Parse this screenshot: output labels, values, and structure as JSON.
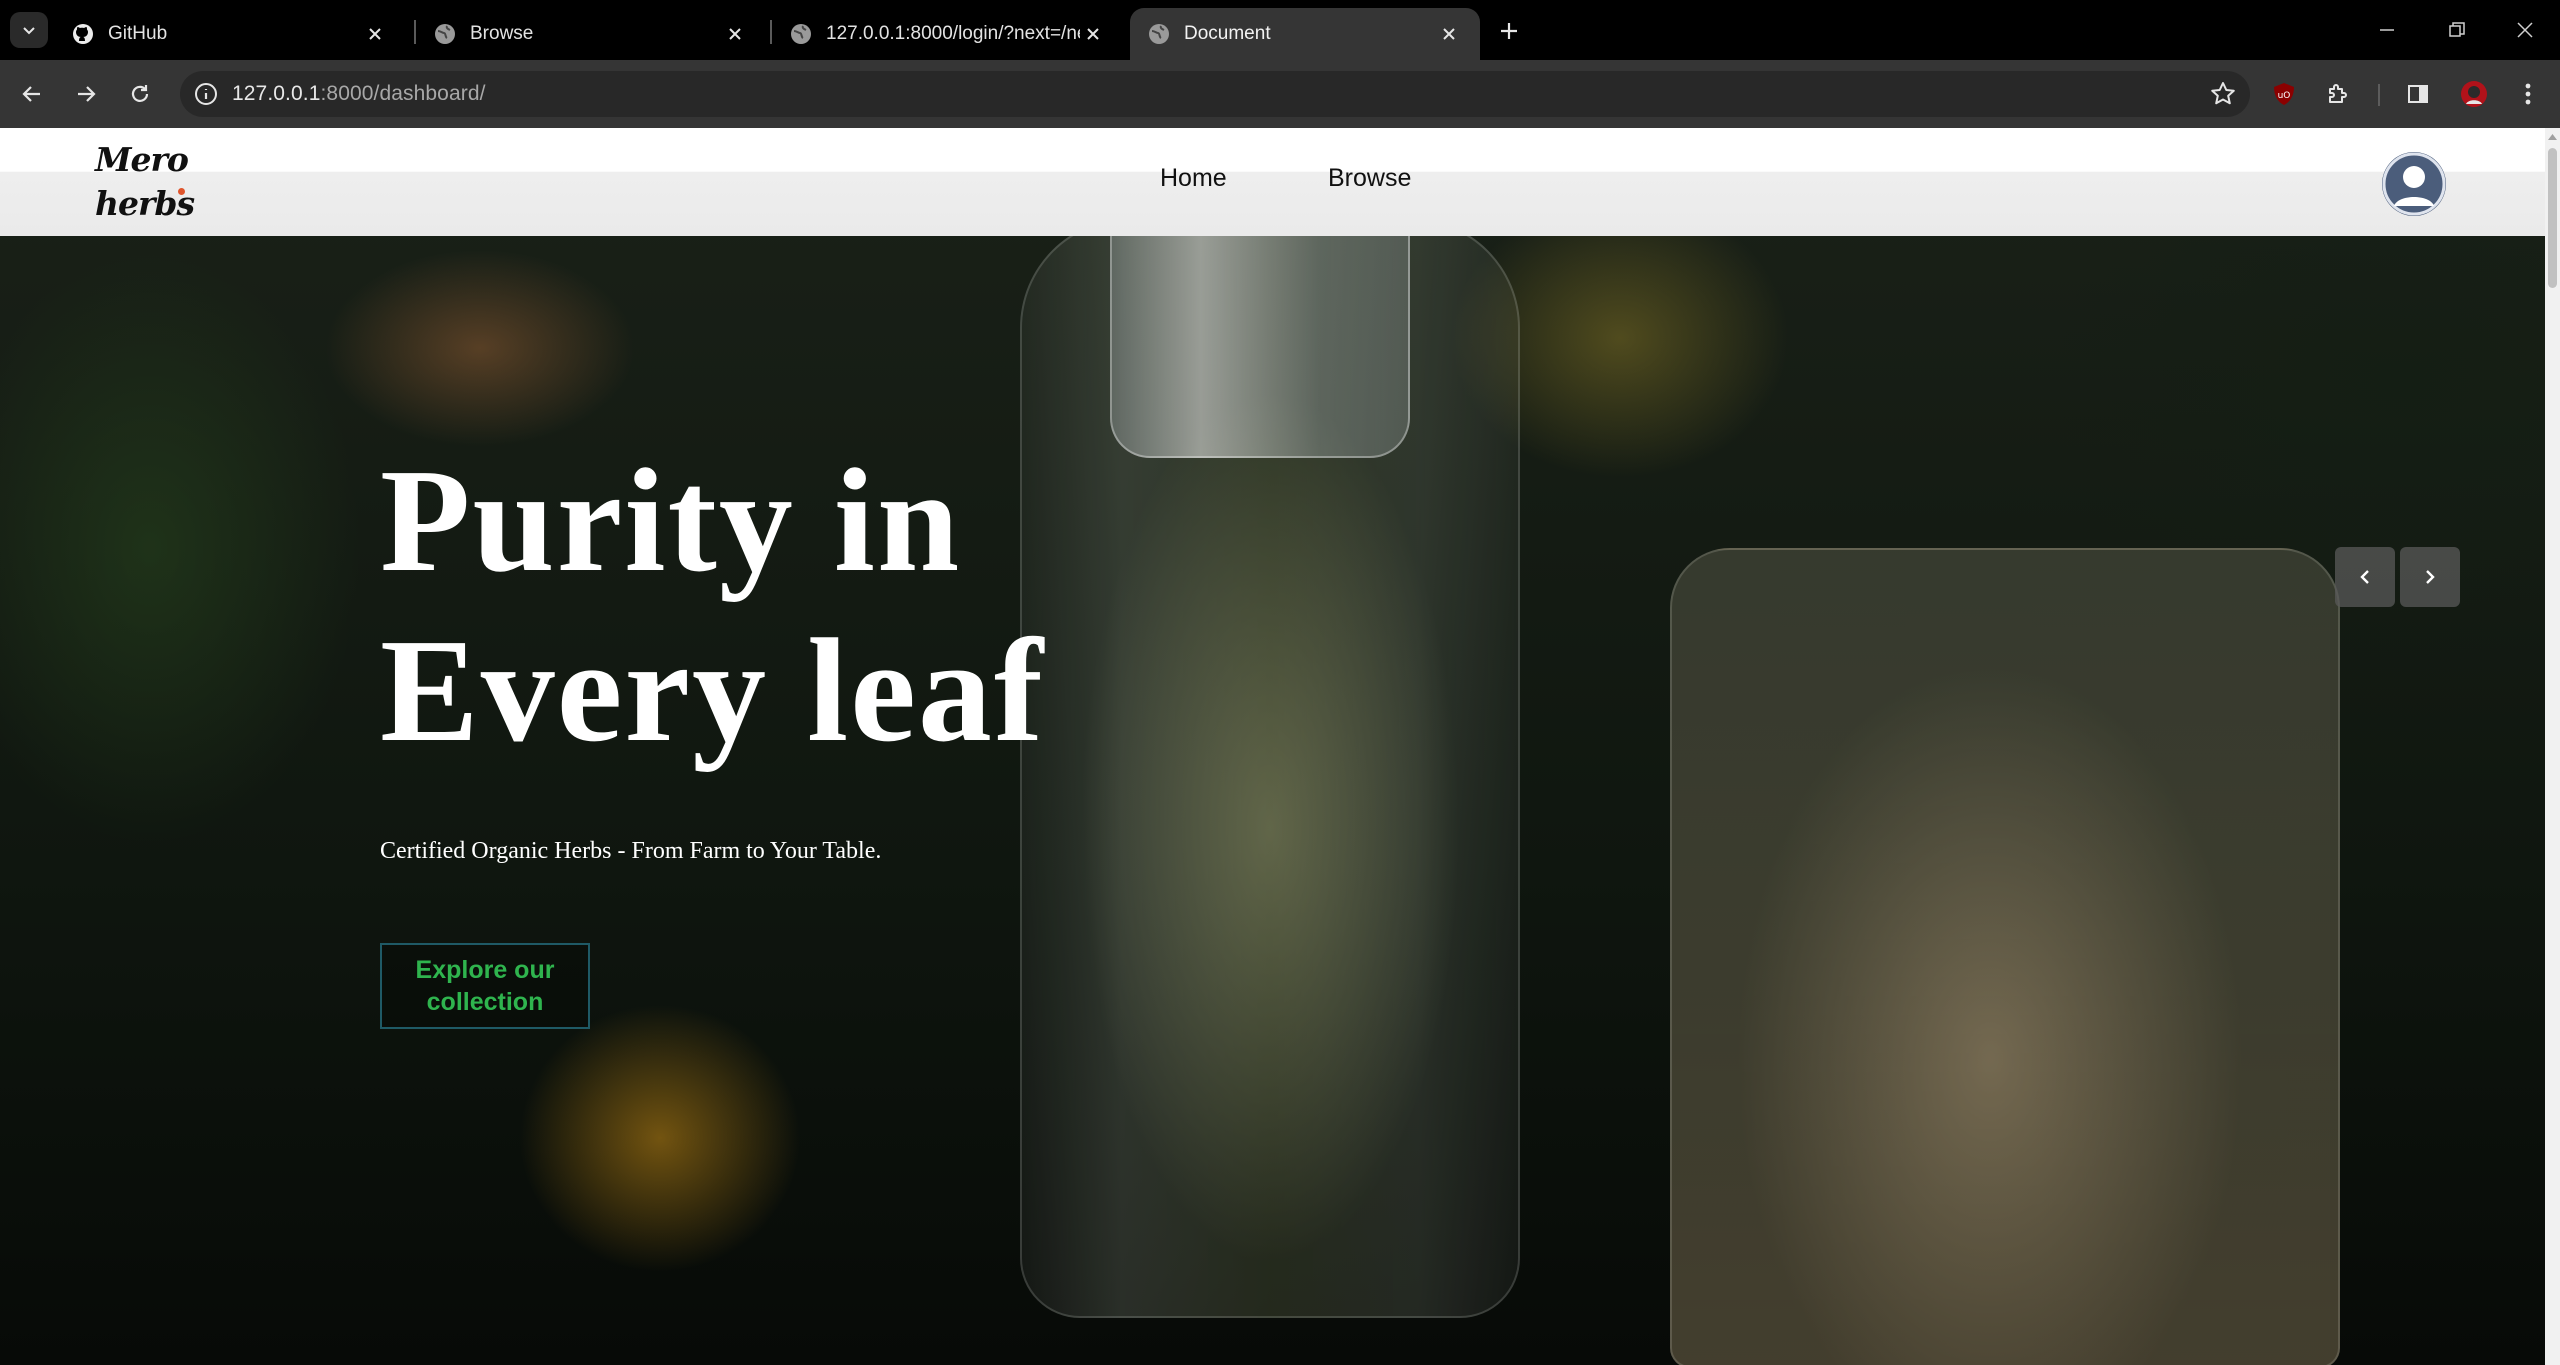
{
  "browser": {
    "tabs": [
      {
        "title": "GitHub",
        "favicon": "github-icon",
        "active": false
      },
      {
        "title": "Browse",
        "favicon": "globe-icon",
        "active": false
      },
      {
        "title": "127.0.0.1:8000/login/?next=/ne",
        "favicon": "globe-icon",
        "active": false
      },
      {
        "title": "Document",
        "favicon": "globe-icon",
        "active": true
      }
    ],
    "url_host": "127.0.0.1",
    "url_rest": ":8000/dashboard/"
  },
  "site": {
    "logo_line1": "Mero",
    "logo_line2": "herbs",
    "nav": [
      {
        "label": "Home"
      },
      {
        "label": "Browse"
      }
    ]
  },
  "hero": {
    "title_line1": "Purity in",
    "title_line2": "Every leaf",
    "subtitle": "Certified Organic Herbs - From Farm to Your Table.",
    "cta_label": "Explore our collection",
    "prev_icon": "chevron-left-icon",
    "next_icon": "chevron-right-icon"
  },
  "colors": {
    "cta_text": "#2fb44e",
    "cta_border": "#1f5a66",
    "logo_dot": "#e0552c",
    "header_bg": "#eaeaea"
  }
}
